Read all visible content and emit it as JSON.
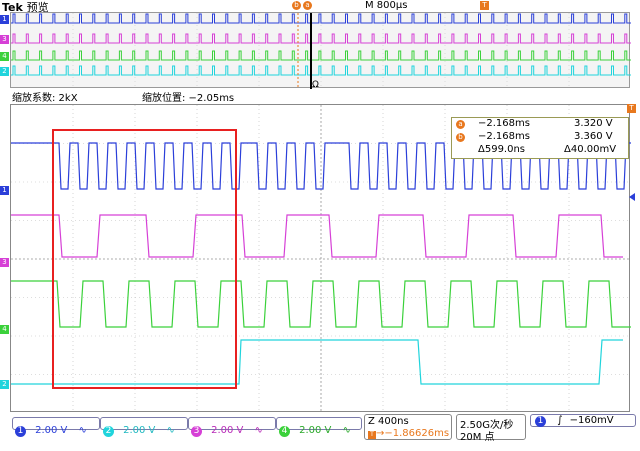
{
  "header": {
    "brand": "Tek",
    "mode": "预览",
    "timebase": "M 800μs",
    "marker_a": "a",
    "marker_b": "b",
    "trigger_marker": "T"
  },
  "zoom": {
    "factor_label": "缩放系数: 2kX",
    "position_label": "缩放位置: −2.05ms",
    "overview_marker": "Ω"
  },
  "channels": [
    {
      "num": "1",
      "scale": "2.00 V",
      "coupling": "∿",
      "color": "#2b3fd9"
    },
    {
      "num": "2",
      "scale": "2.00 V",
      "coupling": "∿",
      "color": "#20d4dc"
    },
    {
      "num": "3",
      "scale": "2.00 V",
      "coupling": "∿",
      "color": "#d640d6"
    },
    {
      "num": "4",
      "scale": "2.00 V",
      "coupling": "∿",
      "color": "#3bd13b"
    }
  ],
  "cursors": {
    "a": {
      "time": "−2.168ms",
      "value": "3.320 V"
    },
    "b": {
      "time": "−2.168ms",
      "value": "3.360 V"
    },
    "delta_time": "Δ599.0ns",
    "delta_value": "Δ40.00mV",
    "a_icon": "a",
    "b_icon": "b"
  },
  "footer": {
    "zoom_time": "Z 400ns",
    "trigger_pos": "−1.86626ms",
    "sample_rate": "2.50G次/秒",
    "record_length": "20M 点",
    "trigger_ch": "1",
    "trigger_slope": "∫",
    "trigger_level": "−160mV"
  },
  "colors": {
    "highlight_box": "#e82020",
    "cursor_panel": "#9a9a55",
    "marker_orange": "#e8781e"
  }
}
